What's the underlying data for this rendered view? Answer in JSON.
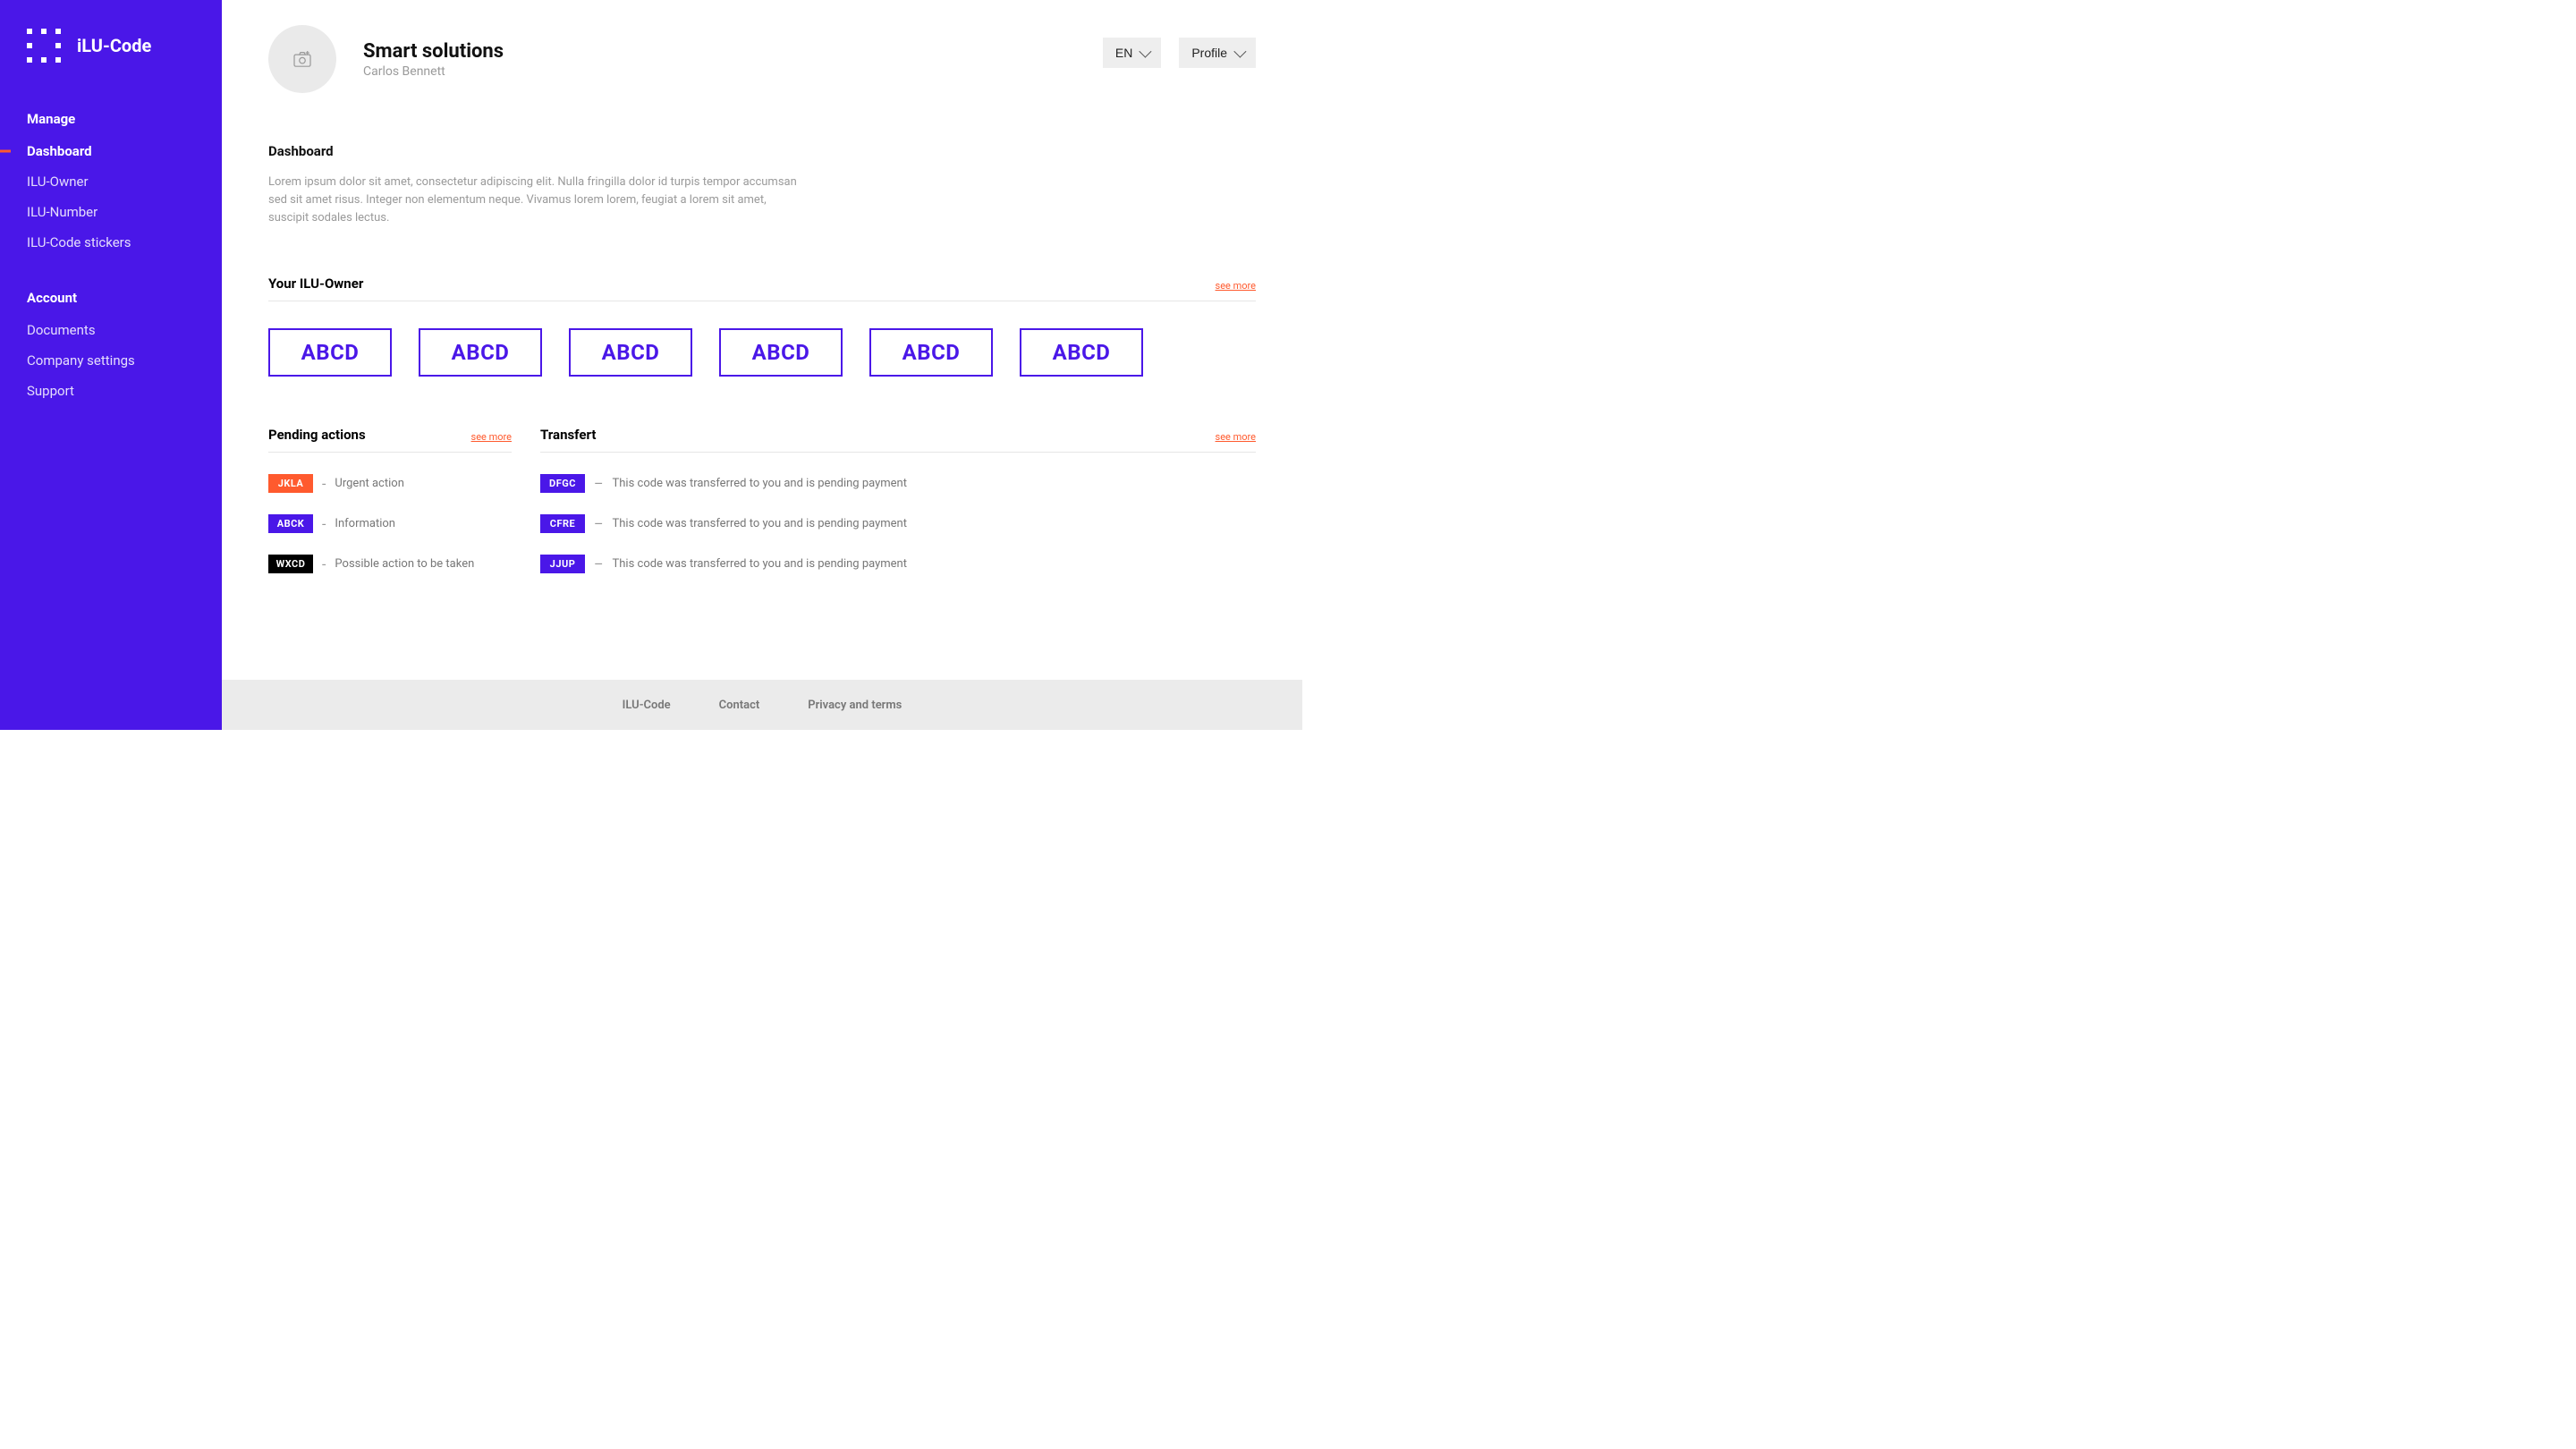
{
  "brand": "iLU-Code",
  "sidebar": {
    "manage_title": "Manage",
    "account_title": "Account",
    "manage_items": [
      {
        "label": "Dashboard",
        "active": true
      },
      {
        "label": "ILU-Owner"
      },
      {
        "label": "ILU-Number"
      },
      {
        "label": "ILU-Code stickers"
      }
    ],
    "account_items": [
      {
        "label": "Documents"
      },
      {
        "label": "Company settings"
      },
      {
        "label": "Support"
      }
    ]
  },
  "header": {
    "company": "Smart solutions",
    "user": "Carlos Bennett",
    "lang_label": "EN",
    "profile_label": "Profile"
  },
  "dashboard": {
    "title": "Dashboard",
    "lead": "Lorem ipsum dolor sit amet, consectetur adipiscing elit. Nulla fringilla dolor id turpis tempor accumsan sed sit amet risus. Integer non elementum neque. Vivamus lorem lorem, feugiat a lorem sit amet, suscipit sodales lectus."
  },
  "owners": {
    "title": "Your ILU-Owner",
    "see_more": "see more",
    "cards": [
      "ABCD",
      "ABCD",
      "ABCD",
      "ABCD",
      "ABCD",
      "ABCD"
    ]
  },
  "pending": {
    "title": "Pending actions",
    "see_more": "see more",
    "items": [
      {
        "code": "JKLA",
        "color": "orange",
        "text": "Urgent action"
      },
      {
        "code": "ABCK",
        "color": "blue",
        "text": "Information"
      },
      {
        "code": "WXCD",
        "color": "black",
        "text": "Possible action to be taken"
      }
    ]
  },
  "transfer": {
    "title": "Transfert",
    "see_more": "see more",
    "items": [
      {
        "code": "DFGC",
        "text": "This code was transferred to you and is pending payment"
      },
      {
        "code": "CFRE",
        "text": "This code was transferred to you and is pending payment"
      },
      {
        "code": "JJUP",
        "text": "This code was transferred to you and is pending payment"
      }
    ]
  },
  "footer": {
    "links": [
      "ILU-Code",
      "Contact",
      "Privacy and terms"
    ]
  }
}
